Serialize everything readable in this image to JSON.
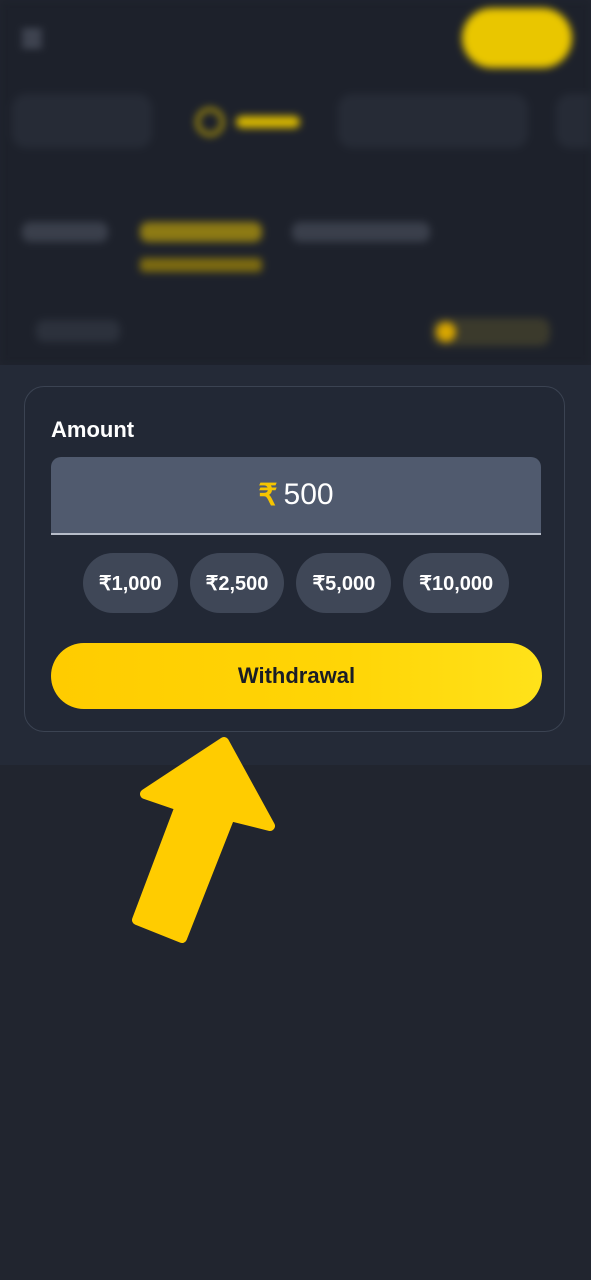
{
  "amount_form": {
    "label": "Amount",
    "currency_symbol": "₹",
    "value": "500",
    "quick_amounts": [
      "₹1,000",
      "₹2,500",
      "₹5,000",
      "₹10,000"
    ],
    "submit_label": "Withdrawal"
  },
  "annotation": {
    "arrow_icon": "arrow-pointing-up-icon",
    "arrow_color": "#ffcc00"
  },
  "colors": {
    "accent": "#ffcc00",
    "background": "#21252f",
    "card": "#222835",
    "input": "#505a6e",
    "chip": "#3f4757"
  }
}
